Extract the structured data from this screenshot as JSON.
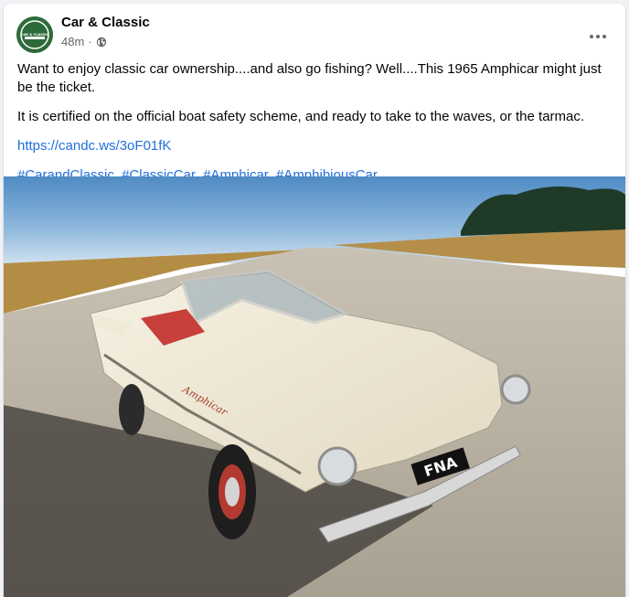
{
  "post": {
    "page_name": "Car & Classic",
    "time": "48m",
    "separator": "·",
    "privacy_icon": "globe-icon",
    "more_icon": "more-dots-icon",
    "text_line1": "Want to enjoy classic car ownership....and also go fishing? Well....This 1965 Amphicar might just be the ticket.",
    "text_line2": "It is certified on the official boat safety scheme, and ready to take to the waves, or the tarmac.",
    "link": "https://candc.ws/3oF01fK",
    "hashtags": [
      "#CarandClassic",
      "#ClassicCar",
      "#Amphicar",
      "#AmphibiousCar"
    ],
    "avatar_logo_text": "CAR & CLASSIC"
  },
  "photo": {
    "plate_text": "FNA",
    "badge_script": "Amphicar"
  },
  "colors": {
    "link": "#216fdb",
    "text": "#050505",
    "meta": "#65676b",
    "avatar_green": "#2e6b3a"
  }
}
